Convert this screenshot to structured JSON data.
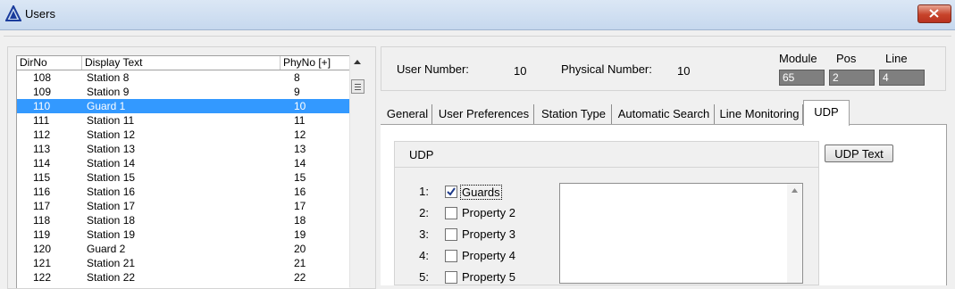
{
  "window": {
    "title": "Users",
    "icon": "triangle-logo-icon",
    "close_icon": "close-icon"
  },
  "list": {
    "columns": [
      "DirNo",
      "Display Text",
      "PhyNo [+]"
    ],
    "rows": [
      {
        "dir": "108",
        "display": "Station 8",
        "phy": "8",
        "selected": false
      },
      {
        "dir": "109",
        "display": "Station 9",
        "phy": "9",
        "selected": false
      },
      {
        "dir": "110",
        "display": "Guard 1",
        "phy": "10",
        "selected": true
      },
      {
        "dir": "111",
        "display": "Station 11",
        "phy": "11",
        "selected": false
      },
      {
        "dir": "112",
        "display": "Station 12",
        "phy": "12",
        "selected": false
      },
      {
        "dir": "113",
        "display": "Station 13",
        "phy": "13",
        "selected": false
      },
      {
        "dir": "114",
        "display": "Station 14",
        "phy": "14",
        "selected": false
      },
      {
        "dir": "115",
        "display": "Station 15",
        "phy": "15",
        "selected": false
      },
      {
        "dir": "116",
        "display": "Station 16",
        "phy": "16",
        "selected": false
      },
      {
        "dir": "117",
        "display": "Station 17",
        "phy": "17",
        "selected": false
      },
      {
        "dir": "118",
        "display": "Station 18",
        "phy": "18",
        "selected": false
      },
      {
        "dir": "119",
        "display": "Station 19",
        "phy": "19",
        "selected": false
      },
      {
        "dir": "120",
        "display": "Guard 2",
        "phy": "20",
        "selected": false
      },
      {
        "dir": "121",
        "display": "Station 21",
        "phy": "21",
        "selected": false
      },
      {
        "dir": "122",
        "display": "Station 22",
        "phy": "22",
        "selected": false
      }
    ]
  },
  "info": {
    "user_number_label": "User Number:",
    "user_number": "10",
    "physical_number_label": "Physical Number:",
    "physical_number": "10",
    "module_label": "Module",
    "module_value": "65",
    "pos_label": "Pos",
    "pos_value": "2",
    "line_label": "Line",
    "line_value": "4"
  },
  "tabs": [
    {
      "label": "General"
    },
    {
      "label": "User Preferences"
    },
    {
      "label": "Station Type"
    },
    {
      "label": "Automatic Search"
    },
    {
      "label": "Line Monitoring"
    },
    {
      "label": "UDP"
    }
  ],
  "active_tab": "UDP",
  "udp": {
    "group_title": "UDP",
    "text_button": "UDP Text",
    "items": [
      {
        "num": "1:",
        "label": "Guards",
        "checked": true
      },
      {
        "num": "2:",
        "label": "Property 2",
        "checked": false
      },
      {
        "num": "3:",
        "label": "Property 3",
        "checked": false
      },
      {
        "num": "4:",
        "label": "Property 4",
        "checked": false
      },
      {
        "num": "5:",
        "label": "Property 5",
        "checked": false
      }
    ]
  },
  "colors": {
    "selection": "#3399ff",
    "position_box": "#7f7f7f",
    "close_button": "#c7432a"
  }
}
